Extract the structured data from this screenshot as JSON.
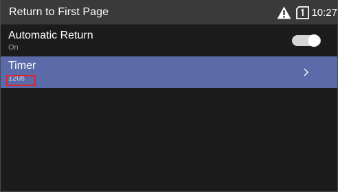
{
  "header": {
    "title": "Return to First Page",
    "time": "10:27",
    "icons": [
      "warning-icon",
      "sim-card-icon"
    ]
  },
  "settings": {
    "automatic_return": {
      "label": "Automatic Return",
      "value": "On",
      "toggle_on": true
    },
    "timer": {
      "label": "Timer",
      "value": "120s",
      "selected": true,
      "icon": "chevron-right-icon"
    }
  },
  "colors": {
    "titlebar": "#3a3a3a",
    "background": "#1c1c1c",
    "selected_row": "#5b6aa8",
    "highlight": "#e0242b"
  }
}
